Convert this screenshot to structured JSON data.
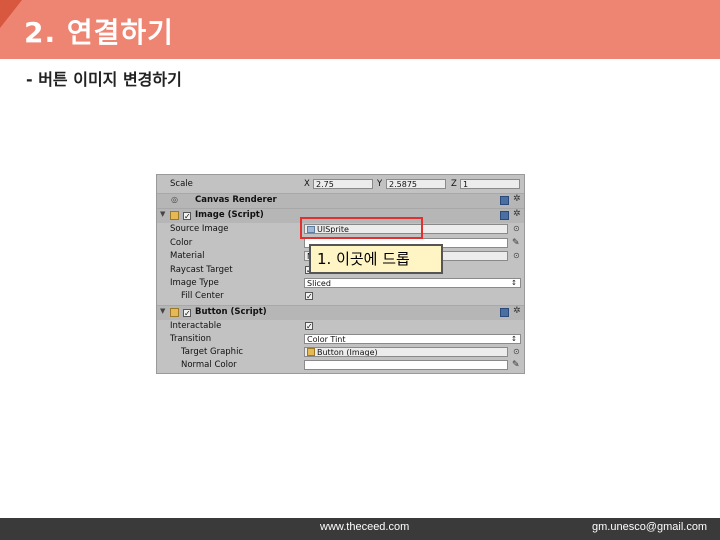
{
  "slide": {
    "title": "2. 연결하기",
    "subtitle": "- 버튼 이미지 변경하기"
  },
  "footer": {
    "website": "www.theceed.com",
    "email": "gm.unesco@gmail.com"
  },
  "inspector": {
    "scale": {
      "label": "Scale",
      "x_label": "X",
      "x": "2.75",
      "y_label": "Y",
      "y": "2.5875",
      "z_label": "Z",
      "z": "1"
    },
    "canvas_renderer": {
      "label": "Canvas Renderer"
    },
    "image_component": {
      "title": "Image (Script)",
      "enabled": true,
      "source_image_label": "Source Image",
      "source_image_value": "UISprite",
      "color_label": "Color",
      "material_label": "Material",
      "material_value": "N",
      "raycast_target_label": "Raycast Target",
      "image_type_label": "Image Type",
      "image_type_value": "Sliced",
      "fill_center_label": "Fill Center",
      "fill_center": true
    },
    "button_component": {
      "title": "Button (Script)",
      "enabled": true,
      "interactable_label": "Interactable",
      "interactable": true,
      "transition_label": "Transition",
      "transition_value": "Color Tint",
      "target_graphic_label": "Target Graphic",
      "target_graphic_value": "Button (Image)",
      "normal_color_label": "Normal Color"
    }
  },
  "callout": {
    "text": "1. 이곳에 드롭"
  },
  "colors": {
    "header": "#ee8472",
    "header_accent": "#d8573f",
    "highlight": "#e03030",
    "callout_bg": "#fff5c4",
    "footer": "#3a3a3a"
  }
}
